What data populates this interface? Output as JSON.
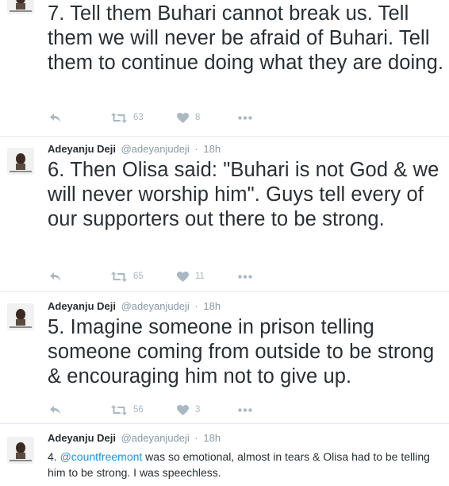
{
  "colors": {
    "text": "#292f33",
    "muted": "#8899a6",
    "icon": "#aab8c2",
    "link": "#1b95e0",
    "divider": "#e1e8ed"
  },
  "tweets": [
    {
      "text": "7. Tell them Buhari cannot break us. Tell them we will never be afraid of Buhari. Tell them to continue doing what they are doing.",
      "retweets": "63",
      "likes": "8"
    },
    {
      "author": "Adeyanju Deji",
      "handle": "@adeyanjudeji",
      "separator": "·",
      "time": "18h",
      "text": "6. Then Olisa said: \"Buhari is not God & we will never worship him\". Guys tell every of our supporters out there to be strong.",
      "retweets": "65",
      "likes": "11"
    },
    {
      "author": "Adeyanju Deji",
      "handle": "@adeyanjudeji",
      "separator": "·",
      "time": "18h",
      "text": "5. Imagine someone in prison telling someone coming from outside to be strong & encouraging him not to give up.",
      "retweets": "56",
      "likes": "3"
    },
    {
      "author": "Adeyanju Deji",
      "handle": "@adeyanjudeji",
      "separator": "·",
      "time": "18h",
      "text_prefix": "4. ",
      "mention": "@countfreemont",
      "text_suffix": " was so emotional, almost in tears & Olisa had to be telling him to be strong. I was speechless."
    }
  ],
  "icons": {
    "reply": "reply-icon",
    "retweet": "retweet-icon",
    "like": "heart-icon",
    "more": "more-dots-icon"
  }
}
